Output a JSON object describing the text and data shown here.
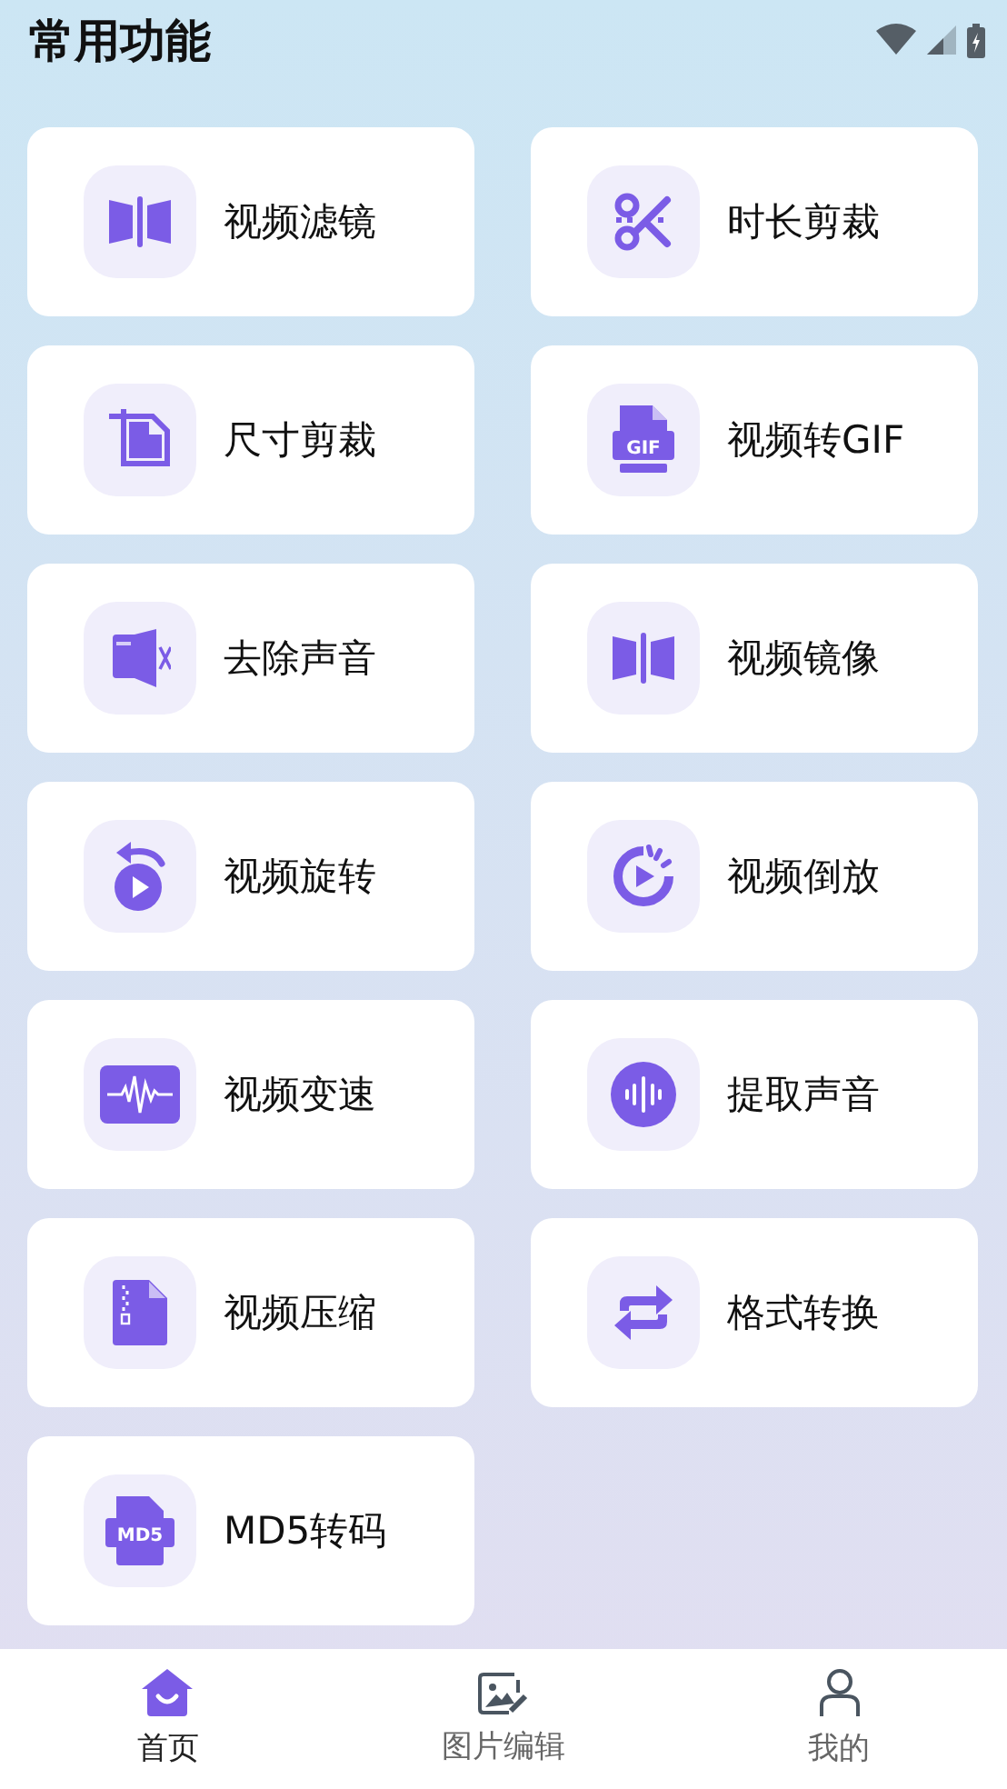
{
  "title": "常用功能",
  "features": [
    {
      "label": "视频滤镜"
    },
    {
      "label": "时长剪裁"
    },
    {
      "label": "尺寸剪裁"
    },
    {
      "label": "视频转GIF",
      "icon_text": "GIF"
    },
    {
      "label": "去除声音"
    },
    {
      "label": "视频镜像"
    },
    {
      "label": "视频旋转"
    },
    {
      "label": "视频倒放"
    },
    {
      "label": "视频变速"
    },
    {
      "label": "提取声音"
    },
    {
      "label": "视频压缩"
    },
    {
      "label": "格式转换"
    },
    {
      "label": "MD5转码",
      "icon_text": "MD5"
    }
  ],
  "nav": [
    {
      "label": "首页",
      "selected": true
    },
    {
      "label": "图片编辑",
      "selected": false
    },
    {
      "label": "我的",
      "selected": false
    }
  ]
}
